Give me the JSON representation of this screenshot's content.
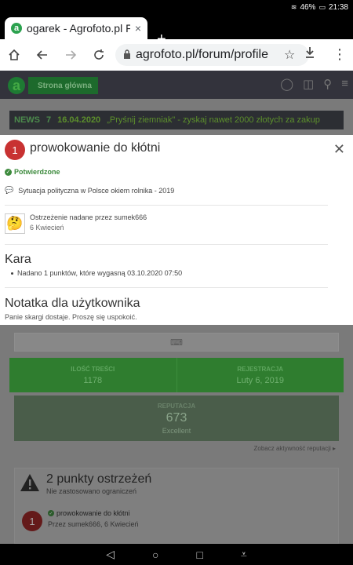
{
  "status": {
    "battery": "46%",
    "time": "21:38"
  },
  "browser": {
    "tab_title": "ogarek - Agrofoto.pl Fo",
    "url": "agrofoto.pl/forum/profile",
    "new_tab": "+",
    "tab_close": "×"
  },
  "site": {
    "home_label": "Strona główna",
    "news_label": "NEWS",
    "news_count": "7",
    "news_date": "16.04.2020",
    "news_text": "„Pryśnij ziemniak\" - zyskaj nawet 2000 złotych za zakup"
  },
  "modal": {
    "badge": "1",
    "title": "prowokowanie do kłótni",
    "status": "Potwierdzone",
    "topic": "Sytuacja polityczna w Polsce okiem rolnika - 2019",
    "warning_by": "Ostrzeżenie nadane przez sumek666",
    "warning_date": "6 Kwiecień",
    "penalty_heading": "Kara",
    "penalty_item": "Nadano 1 punktów, które wygasną 03.10.2020 07:50",
    "note_heading": "Notatka dla użytkownika",
    "note_text": "Panie skargi dostaje. Proszę się uspokoić."
  },
  "profile": {
    "content_count_label": "ILOŚĆ TREŚCI",
    "content_count": "1178",
    "registered_label": "REJESTRACJA",
    "registered": "Luty 6, 2019",
    "reputation_label": "REPUTACJA",
    "reputation": "673",
    "reputation_level": "Excellent",
    "reputation_link": "Zobacz aktywność reputacji",
    "warnings_title": "2 punkty ostrzeżeń",
    "warnings_sub": "Nie zastosowano ograniczeń",
    "warning_badge": "1",
    "warning_name": "prowokowanie do kłótni",
    "warning_meta": "Przez sumek666, 6 Kwiecień"
  }
}
